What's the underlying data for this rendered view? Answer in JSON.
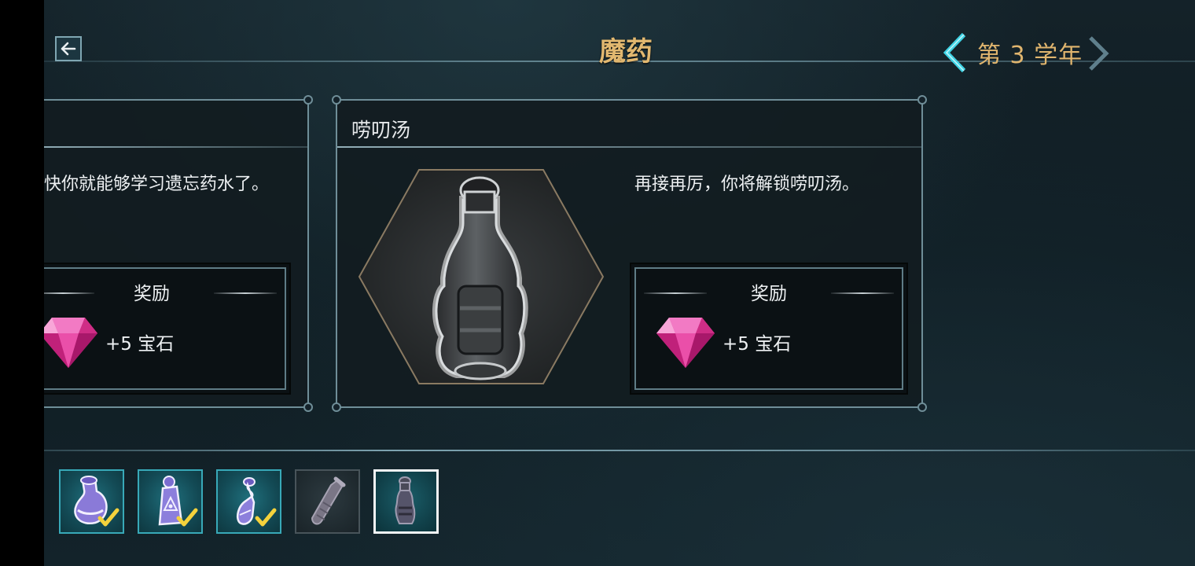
{
  "header": {
    "back_icon": "arrow-left-icon",
    "title": "魔药",
    "year_label": "第 3 学年",
    "prev_icon": "chevron-left-icon",
    "next_icon": "chevron-right-icon"
  },
  "cards": [
    {
      "title": "",
      "description": "快你就能够学习遗忘药水了。",
      "reward_title": "奖励",
      "reward_text": "+5 宝石",
      "reward_icon": "gem-icon"
    },
    {
      "title": "唠叨汤",
      "description": "再接再厉，你将解锁唠叨汤。",
      "image_icon": "potion-bottle-icon",
      "reward_title": "奖励",
      "reward_text": "+5 宝石",
      "reward_icon": "gem-icon"
    }
  ],
  "potion_slots": [
    {
      "icon": "potion-flask-icon",
      "state": "completed"
    },
    {
      "icon": "potion-eye-bottle-icon",
      "state": "completed"
    },
    {
      "icon": "potion-vial-icon",
      "state": "completed"
    },
    {
      "icon": "potion-tube-icon",
      "state": "locked"
    },
    {
      "icon": "potion-bottle-icon",
      "state": "selected"
    }
  ],
  "colors": {
    "title_gold": "#e2b870",
    "accent_cyan": "#38a9b8",
    "gem_pink": "#e0379a"
  }
}
